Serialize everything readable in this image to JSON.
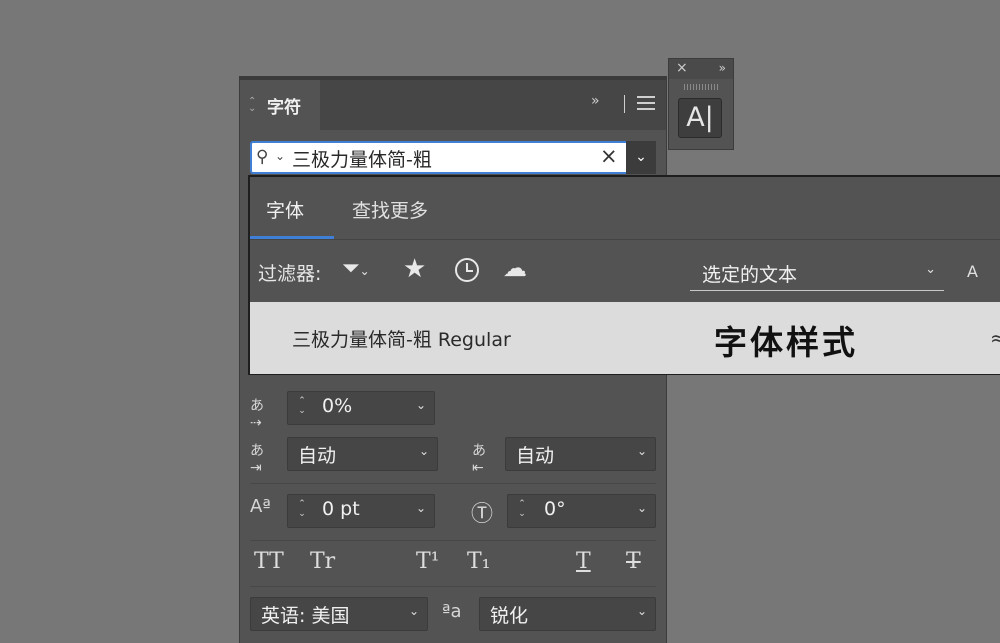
{
  "mini_panel": {
    "close_glyph": "×",
    "expand_glyph": "»",
    "tool_label": "A|"
  },
  "panel": {
    "tab_label": "字符",
    "collapse_glyph": "»"
  },
  "font_search": {
    "value": "三极力量体简-粗",
    "clear_glyph": "×",
    "dropdown_glyph": "⌄"
  },
  "font_popup": {
    "tabs": [
      "字体",
      "查找更多"
    ],
    "filter_label": "过滤器:",
    "preview_select": "选定的文本",
    "preview_size_glyph": "A",
    "result": {
      "name": "三极力量体简-粗 Regular",
      "sample": "字体样式"
    }
  },
  "controls": {
    "tsume": "0%",
    "aki_left": "自动",
    "aki_right": "自动",
    "baseline_shift": "0 pt",
    "char_rotation": "0°",
    "language": "英语: 美国",
    "antialias": "锐化",
    "antialias_glyph": "ªa"
  },
  "type_buttons": [
    "TT",
    "Tr",
    "T¹",
    "T₁",
    "T",
    "T"
  ],
  "colors": {
    "background": "#777777",
    "panel": "#535353",
    "accent": "#3f7fd6"
  }
}
